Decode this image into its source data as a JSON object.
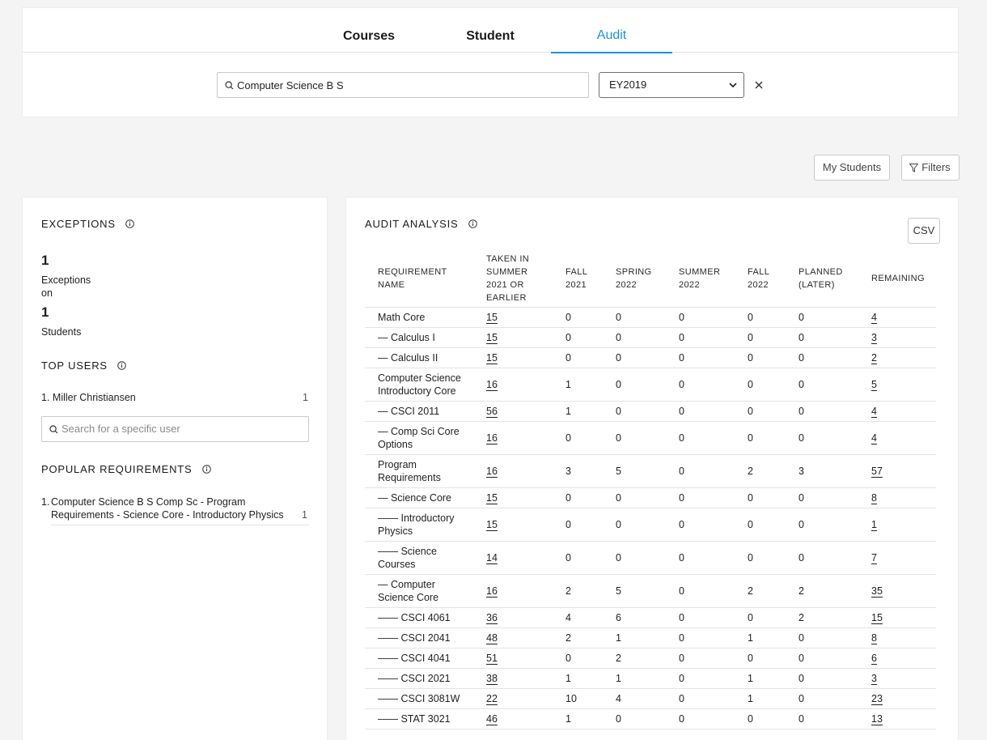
{
  "tabs": [
    {
      "label": "Courses"
    },
    {
      "label": "Student"
    },
    {
      "label": "Audit"
    }
  ],
  "search": {
    "value": "Computer Science B S"
  },
  "year_select": {
    "value": "EY2019"
  },
  "toolbar": {
    "my_students": "My Students",
    "filters": "Filters"
  },
  "exceptions": {
    "title": "EXCEPTIONS",
    "count": "1",
    "exceptions_label": "Exceptions",
    "on_label": "on",
    "students_count": "1",
    "students_label": "Students"
  },
  "top_users": {
    "title": "TOP USERS",
    "items": [
      {
        "rank": "1.",
        "name": "Miller Christiansen",
        "count": "1"
      }
    ],
    "search_placeholder": "Search for a specific user"
  },
  "popular_requirements": {
    "title": "POPULAR REQUIREMENTS",
    "items": [
      {
        "rank": "1.",
        "name": "Computer Science B S Comp Sc - Program Requirements - Science Core - Introductory Physics",
        "count": "1"
      }
    ]
  },
  "audit": {
    "title": "AUDIT ANALYSIS",
    "csv_label": "CSV",
    "columns": [
      "REQUIREMENT NAME",
      "TAKEN IN SUMMER 2021 OR EARLIER",
      "FALL 2021",
      "SPRING 2022",
      "SUMMER 2022",
      "FALL 2022",
      "PLANNED (LATER)",
      "REMAINING"
    ],
    "rows": [
      [
        "Math Core",
        "15",
        "0",
        "0",
        "0",
        "0",
        "0",
        "4"
      ],
      [
        "— Calculus I",
        "15",
        "0",
        "0",
        "0",
        "0",
        "0",
        "3"
      ],
      [
        "— Calculus II",
        "15",
        "0",
        "0",
        "0",
        "0",
        "0",
        "2"
      ],
      [
        "Computer Science Introductory Core",
        "16",
        "1",
        "0",
        "0",
        "0",
        "0",
        "5"
      ],
      [
        "— CSCI 2011",
        "56",
        "1",
        "0",
        "0",
        "0",
        "0",
        "4"
      ],
      [
        "— Comp Sci Core Options",
        "16",
        "0",
        "0",
        "0",
        "0",
        "0",
        "4"
      ],
      [
        "Program Requirements",
        "16",
        "3",
        "5",
        "0",
        "2",
        "3",
        "57"
      ],
      [
        "— Science Core",
        "15",
        "0",
        "0",
        "0",
        "0",
        "0",
        "8"
      ],
      [
        "—— Introductory Physics",
        "15",
        "0",
        "0",
        "0",
        "0",
        "0",
        "1"
      ],
      [
        "—— Science Courses",
        "14",
        "0",
        "0",
        "0",
        "0",
        "0",
        "7"
      ],
      [
        "— Computer Science Core",
        "16",
        "2",
        "5",
        "0",
        "2",
        "2",
        "35"
      ],
      [
        "—— CSCI 4061",
        "36",
        "4",
        "6",
        "0",
        "0",
        "2",
        "15"
      ],
      [
        "—— CSCI 2041",
        "48",
        "2",
        "1",
        "0",
        "1",
        "0",
        "8"
      ],
      [
        "—— CSCI 4041",
        "51",
        "0",
        "2",
        "0",
        "0",
        "0",
        "6"
      ],
      [
        "—— CSCI 2021",
        "38",
        "1",
        "1",
        "0",
        "1",
        "0",
        "3"
      ],
      [
        "—— CSCI 3081W",
        "22",
        "10",
        "4",
        "0",
        "1",
        "0",
        "23"
      ],
      [
        "—— STAT 3021",
        "46",
        "1",
        "0",
        "0",
        "0",
        "0",
        "13"
      ]
    ]
  }
}
